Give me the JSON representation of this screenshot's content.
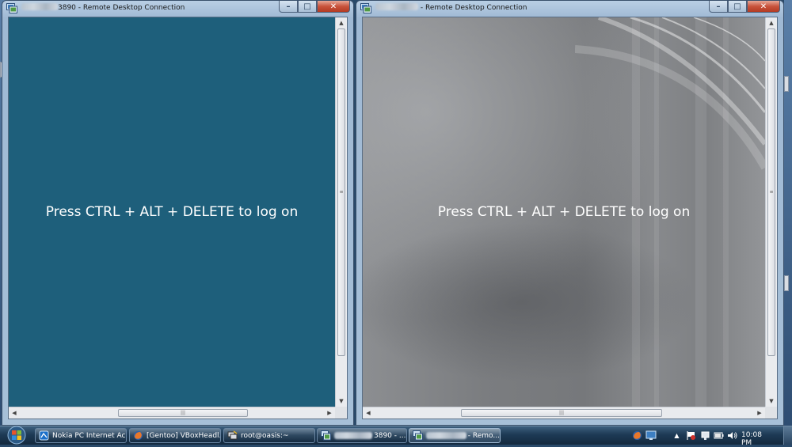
{
  "windows": {
    "left": {
      "title_suffix": "3890 - Remote Desktop Connection",
      "logon_text": "Press CTRL + ALT + DELETE to log on",
      "background": "#1e5f7b"
    },
    "right": {
      "title_suffix": " - Remote Desktop Connection",
      "logon_text": "Press CTRL + ALT + DELETE to log on",
      "background": "#7b7d80"
    }
  },
  "window_controls": {
    "minimize": "–",
    "maximize": "□",
    "close": "✕"
  },
  "scrollbar": {
    "up": "▲",
    "down": "▼",
    "left": "◀",
    "right": "▶",
    "grip_v": "≡",
    "grip_h": "|||"
  },
  "taskbar": {
    "items": [
      {
        "label": "Nokia PC Internet Ac...",
        "icon": "nokia-icon"
      },
      {
        "label": "[Gentoo] VBoxHeadl...",
        "icon": "firefox-icon"
      },
      {
        "label": "root@oasis:~",
        "icon": "putty-icon"
      },
      {
        "label": "3890 - ...",
        "icon": "remote-desktop-icon"
      },
      {
        "label": "- Remo...",
        "icon": "remote-desktop-icon",
        "active": true
      }
    ],
    "tray": {
      "expand": "▲",
      "clock": "10:08 PM",
      "icons": [
        "firefox-icon",
        "display-icon",
        "flag-icon",
        "network-icon",
        "battery-icon",
        "volume-icon"
      ]
    }
  },
  "colors": {
    "taskbar": "#1d3a55",
    "close_button": "#c8533c",
    "teal_session": "#1e5f7b"
  }
}
